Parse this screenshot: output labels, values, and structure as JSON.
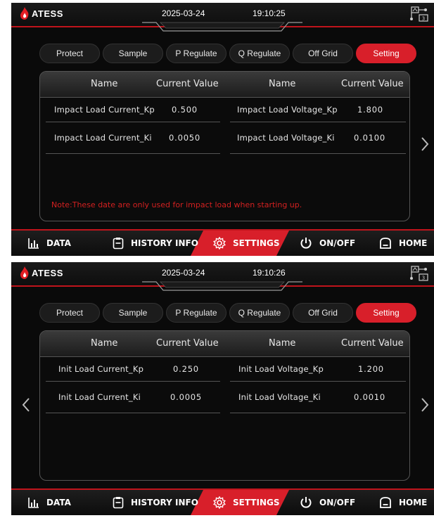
{
  "colors": {
    "accent_red": "#d81f2a",
    "note_red": "#d32020",
    "screen_bg": "#0a0a0a"
  },
  "screens": [
    {
      "header": {
        "brand": "ATESS",
        "date": "2025-03-24",
        "time": "19:10:25",
        "comm_badge": "3"
      },
      "tabs": [
        {
          "label": "Protect",
          "active": false
        },
        {
          "label": "Sample",
          "active": false
        },
        {
          "label": "P Regulate",
          "active": false
        },
        {
          "label": "Q Regulate",
          "active": false
        },
        {
          "label": "Off Grid",
          "active": false
        },
        {
          "label": "Setting",
          "active": true
        }
      ],
      "table": {
        "headers": {
          "name_left": "Name",
          "value_left": "Current Value",
          "name_right": "Name",
          "value_right": "Current Value"
        },
        "left": [
          {
            "name": "Impact Load Current_Kp",
            "value": "0.500"
          },
          {
            "name": "Impact Load Current_Ki",
            "value": "0.0050"
          }
        ],
        "right": [
          {
            "name": "Impact Load Voltage_Kp",
            "value": "1.800"
          },
          {
            "name": "Impact Load Voltage_Ki",
            "value": "0.0100"
          }
        ]
      },
      "note": "Note:These date are only used for impact load when starting up.",
      "nav": [
        {
          "label": "DATA",
          "icon": "bar-chart-icon"
        },
        {
          "label": "HISTORY INFO",
          "icon": "clipboard-icon"
        },
        {
          "label": "SETTINGS",
          "icon": "gear-icon",
          "active": true
        },
        {
          "label": "ON/OFF",
          "icon": "power-icon"
        },
        {
          "label": "HOME",
          "icon": "home-icon"
        }
      ]
    },
    {
      "header": {
        "brand": "ATESS",
        "date": "2025-03-24",
        "time": "19:10:26",
        "comm_badge": "3"
      },
      "tabs": [
        {
          "label": "Protect",
          "active": false
        },
        {
          "label": "Sample",
          "active": false
        },
        {
          "label": "P Regulate",
          "active": false
        },
        {
          "label": "Q Regulate",
          "active": false
        },
        {
          "label": "Off Grid",
          "active": false
        },
        {
          "label": "Setting",
          "active": true
        }
      ],
      "table": {
        "headers": {
          "name_left": "Name",
          "value_left": "Current Value",
          "name_right": "Name",
          "value_right": "Current Value"
        },
        "left": [
          {
            "name": "Init Load Current_Kp",
            "value": "0.250"
          },
          {
            "name": "Init Load Current_Ki",
            "value": "0.0005"
          }
        ],
        "right": [
          {
            "name": "Init Load Voltage_Kp",
            "value": "1.200"
          },
          {
            "name": "Init Load Voltage_Ki",
            "value": "0.0010"
          }
        ]
      },
      "note": "",
      "nav": [
        {
          "label": "DATA",
          "icon": "bar-chart-icon"
        },
        {
          "label": "HISTORY INFO",
          "icon": "clipboard-icon"
        },
        {
          "label": "SETTINGS",
          "icon": "gear-icon",
          "active": true
        },
        {
          "label": "ON/OFF",
          "icon": "power-icon"
        },
        {
          "label": "HOME",
          "icon": "home-icon"
        }
      ]
    }
  ]
}
